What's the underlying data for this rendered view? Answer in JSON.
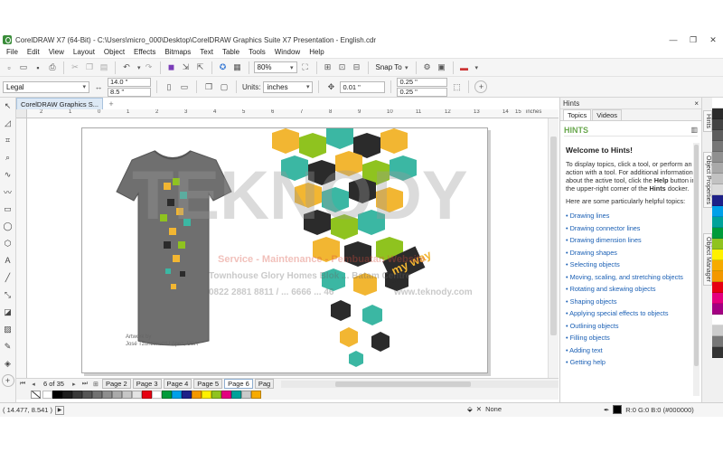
{
  "window": {
    "title": "CorelDRAW X7 (64-Bit) - C:\\Users\\micro_000\\Desktop\\CorelDRAW Graphics Suite X7 Presentation - English.cdr",
    "minimize": "—",
    "maximize": "❐",
    "close": "✕"
  },
  "menu": [
    "File",
    "Edit",
    "View",
    "Layout",
    "Object",
    "Effects",
    "Bitmaps",
    "Text",
    "Table",
    "Tools",
    "Window",
    "Help"
  ],
  "toolbar": {
    "zoom": "80%",
    "snap_to": "Snap To"
  },
  "propbar": {
    "paper_size": "Legal",
    "width": "14.0 \"",
    "height": "8.5 \"",
    "units_label": "Units:",
    "units": "inches",
    "nudge": "0.01 \"",
    "dup_x": "0.25 \"",
    "dup_y": "0.25 \""
  },
  "doc_tab": {
    "label": "CorelDRAW Graphics S..."
  },
  "ruler": {
    "unit": "inches",
    "labels": [
      "2",
      "1",
      "0",
      "1",
      "2",
      "3",
      "4",
      "5",
      "6",
      "7",
      "8",
      "9",
      "10",
      "11",
      "12",
      "13",
      "14",
      "15"
    ]
  },
  "artwork": {
    "credit_line1": "Artwork by",
    "credit_line2": "José Tzontlimatzi López, USA",
    "text_art": "my way"
  },
  "watermark": {
    "brand": "TEKNODY",
    "line1": "Service - Maintenance - Pembuatan Website",
    "line2": "Townhouse Glory Homes Blok ... Batam Centre",
    "line3": "0822 2881 8811 / ... 6666 ... 46",
    "site": "www.teknody.com"
  },
  "pages": {
    "counter": "6 of 35",
    "tabs": [
      "Page 2",
      "Page 3",
      "Page 4",
      "Page 5",
      "Page 6",
      "Pag"
    ],
    "active": "Page 6"
  },
  "palette_colors": [
    "#ffffff",
    "#000000",
    "#1c1c1c",
    "#383838",
    "#555555",
    "#717171",
    "#8e8e8e",
    "#aaaaaa",
    "#c6c6c6",
    "#e3e3e3",
    "#e60012",
    "#ffffff",
    "#009b3a",
    "#00a0e9",
    "#1d2088",
    "#f39800",
    "#fff100",
    "#8fc31f",
    "#e4007f",
    "#00a29a",
    "#c9caca",
    "#f6ab00"
  ],
  "right_palette_colors": [
    "#ffffff",
    "#2b2b2b",
    "#444444",
    "#5e5e5e",
    "#777777",
    "#909090",
    "#a9a9a9",
    "#c2c2c2",
    "#dbdbdb",
    "#1d2088",
    "#00a0e9",
    "#00a29a",
    "#009b3a",
    "#8fc31f",
    "#fff100",
    "#f6ab00",
    "#f39800",
    "#e60012",
    "#e4007f",
    "#a40082",
    "#ffffff",
    "#cccccc",
    "#777777",
    "#333333"
  ],
  "status": {
    "coords": "( 14.477, 8.541 )",
    "fill_label": "None",
    "outline_label": "R:0 G:0 B:0 (#000000)"
  },
  "docker": {
    "title": "Hints",
    "tabs": [
      "Topics",
      "Videos"
    ],
    "header": "HINTS",
    "welcome": "Welcome to Hints!",
    "intro_a": "To display topics, click a tool, or perform an action with a tool. For additional information about the active tool, click the ",
    "intro_help": "Help",
    "intro_b": " button in the upper-right corner of the ",
    "intro_hints": "Hints",
    "intro_c": " docker.",
    "helpful": "Here are some particularly helpful topics:",
    "topics": [
      "• Drawing lines",
      "• Drawing connector lines",
      "• Drawing dimension lines",
      "• Drawing shapes",
      "• Selecting objects",
      "• Moving, scaling, and stretching objects",
      "• Rotating and skewing objects",
      "• Shaping objects",
      "• Applying special effects to objects",
      "• Outlining objects",
      "• Filling objects",
      "• Adding text",
      "• Getting help"
    ]
  },
  "side_tabs": [
    "Hints",
    "Object Properties",
    "Object Manager"
  ]
}
